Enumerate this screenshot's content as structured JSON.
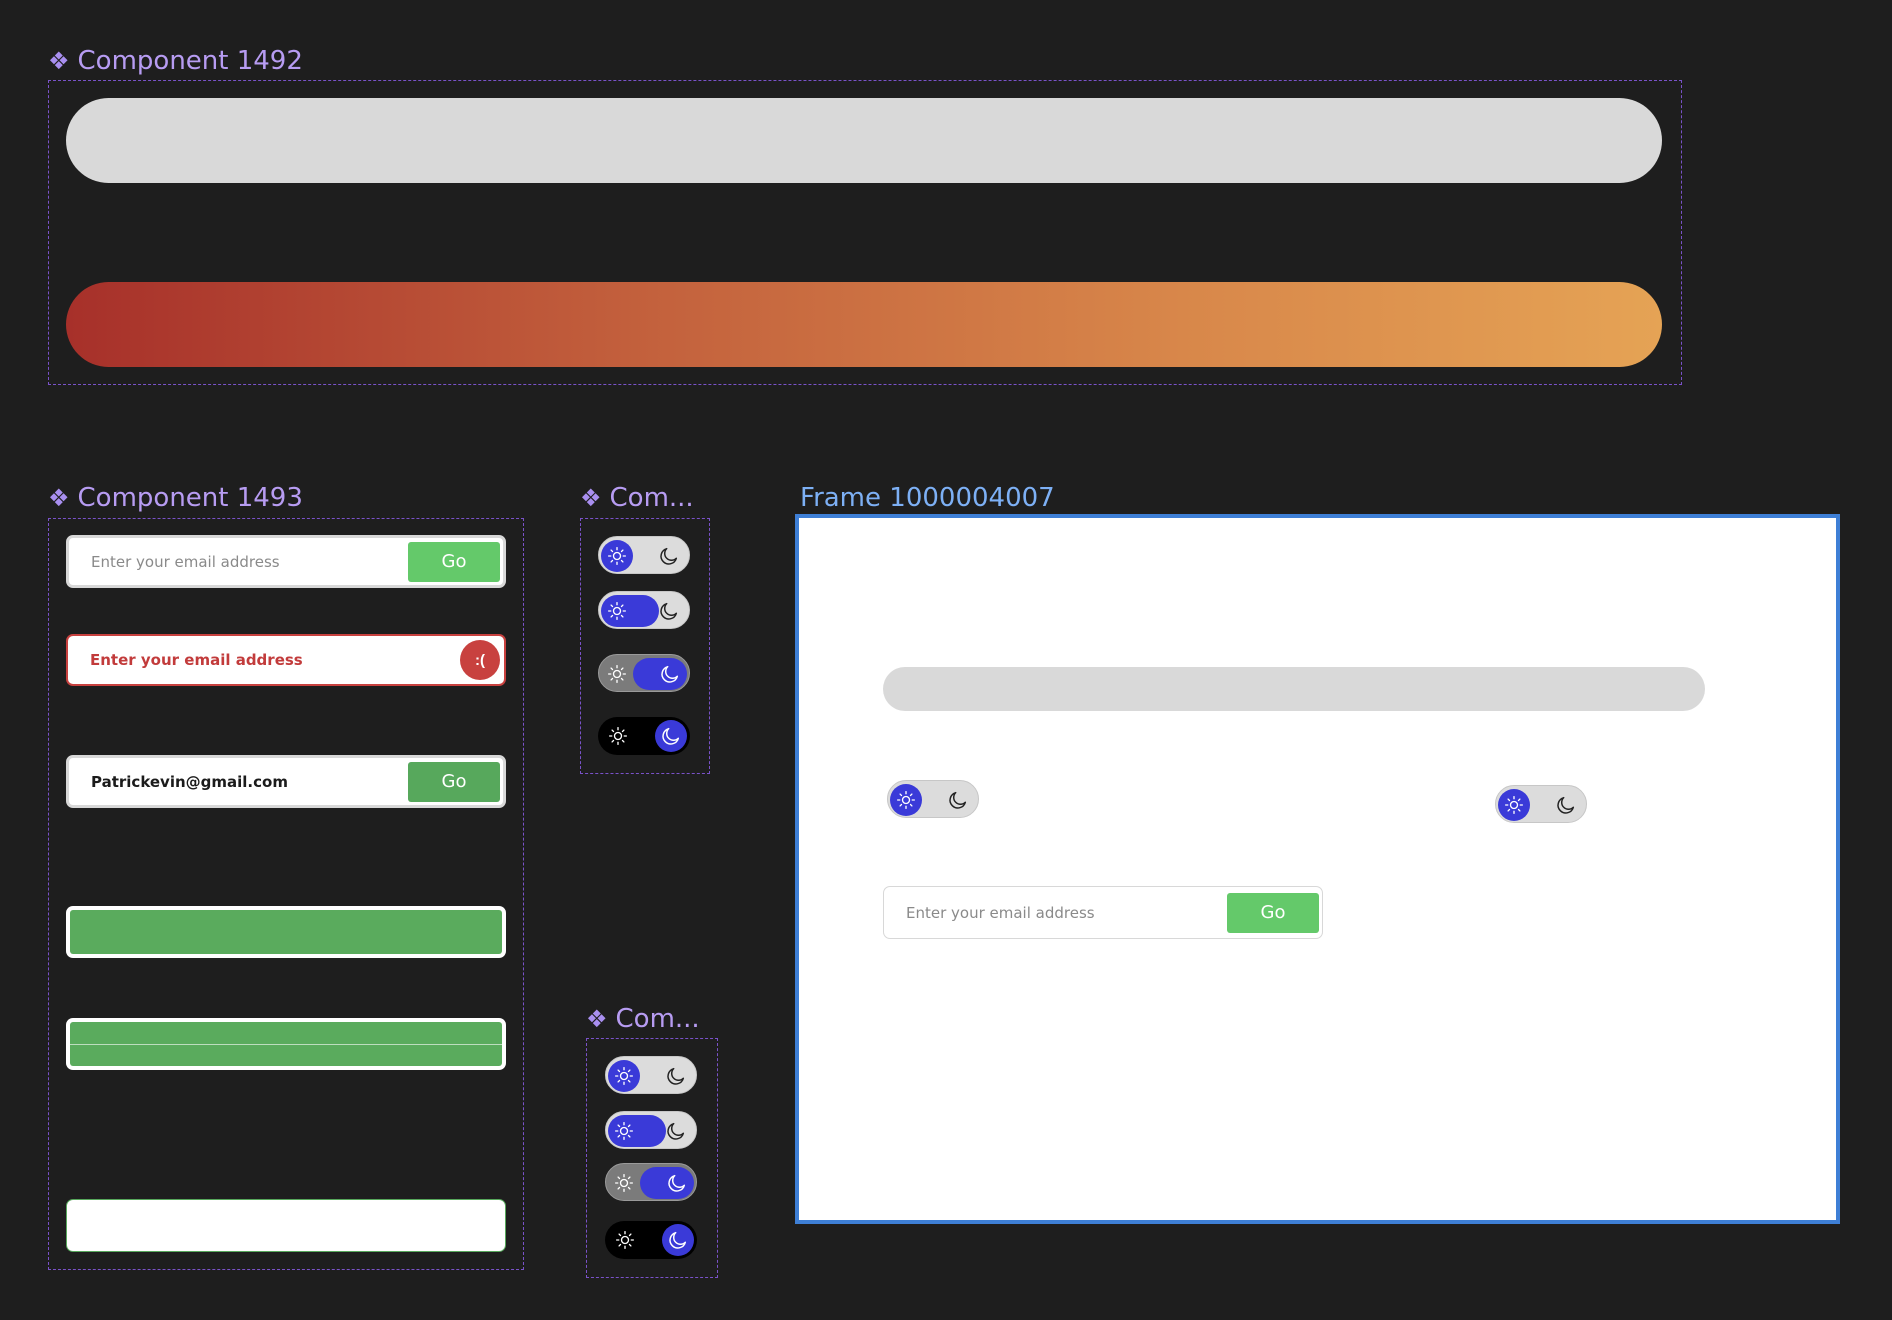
{
  "labels": {
    "component_1492": "Component 1492",
    "component_1493": "Component 1493",
    "component_truncated_a": "Com...",
    "component_truncated_b": "Com...",
    "frame": "Frame 1000004007",
    "component_icon": "❖"
  },
  "email": {
    "placeholder": "Enter your email address",
    "go_label": "Go",
    "error_placeholder": "Enter your email address",
    "error_icon_text": ":(",
    "filled_value": "Patrickevin@gmail.com"
  },
  "frame_email": {
    "placeholder": "Enter your email address",
    "go_label": "Go"
  },
  "icons": {
    "sun": "sun-icon",
    "moon": "moon-icon",
    "component": "component-icon"
  },
  "colors": {
    "canvas_bg": "#1e1e1e",
    "component_label": "#b79cf2",
    "frame_label": "#7db0f5",
    "dashed_border": "#7a52c9",
    "frame_border": "#3e7fd6",
    "toggle_blue": "#3a3ad8",
    "go_green": "#64c96a",
    "go_green_dark": "#57a85c",
    "error_red": "#c8413f",
    "bar_grey": "#d9d9d9",
    "gradient_start": "#a7302a",
    "gradient_end": "#e5a355"
  }
}
